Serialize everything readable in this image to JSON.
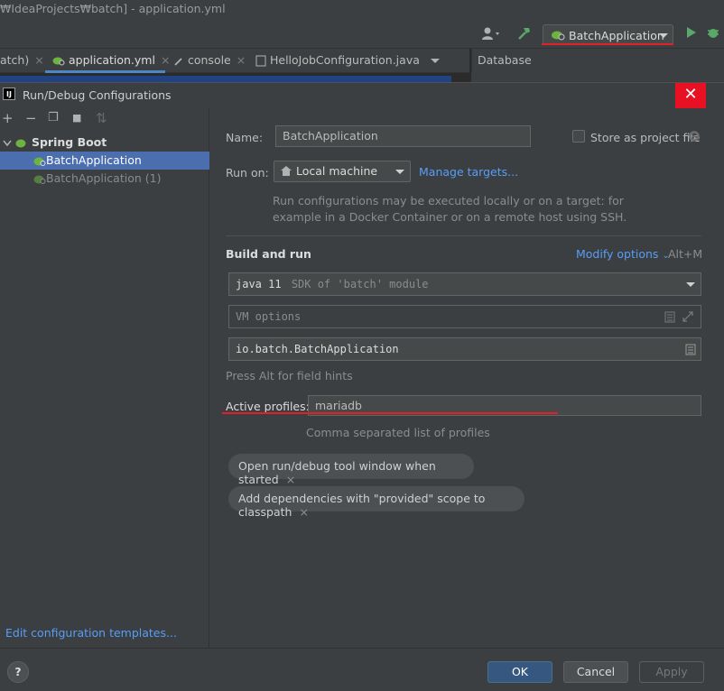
{
  "ide": {
    "window_title": "₩IdeaProjects₩batch] - application.yml",
    "run_config": "BatchApplication",
    "tabs": [
      {
        "label": "atch)"
      },
      {
        "label": "application.yml"
      },
      {
        "label": "console"
      },
      {
        "label": "HelloJobConfiguration.java"
      }
    ],
    "tab_close": "×",
    "database_label": "Database"
  },
  "dialog": {
    "title": "Run/Debug Configurations",
    "logo_text": "IJ",
    "close_glyph": "✕",
    "toolbar": {
      "add": "+",
      "remove": "−",
      "copy": "❐",
      "folder": "■",
      "sort": "⇅"
    },
    "tree": {
      "group_label": "Spring Boot",
      "items": [
        {
          "label": "BatchApplication",
          "selected": true
        },
        {
          "label": "BatchApplication (1)",
          "selected": false
        }
      ]
    },
    "edit_templates_link": "Edit configuration templates...",
    "name_label": "Name:",
    "name_value": "BatchApplication",
    "store_label": "Store as project file",
    "run_on_label": "Run on:",
    "run_on_value": "Local machine",
    "manage_targets": "Manage targets...",
    "run_on_hint_line1": "Run configurations may be executed locally or on a target: for",
    "run_on_hint_line2": "example in a Docker Container or on a remote host using SSH.",
    "build_run_label": "Build and run",
    "modify_options": "Modify options",
    "modify_shortcut": "Alt+M",
    "sdk_value": "java 11",
    "sdk_hint": "SDK of 'batch' module",
    "vm_placeholder": "VM options",
    "main_class": "io.batch.BatchApplication",
    "field_hints": "Press Alt for field hints",
    "active_profiles_label": "Active profiles:",
    "active_profiles_value": "mariadb",
    "profiles_hint": "Comma separated list of profiles",
    "chip_open_tool_window": "Open run/debug tool window when started",
    "chip_add_dependencies": "Add dependencies with \"provided\" scope to classpath",
    "chip_close": "×",
    "help": "?",
    "ok": "OK",
    "cancel": "Cancel",
    "apply": "Apply"
  },
  "colors": {
    "accent": "#4b6eaf",
    "link": "#589df6",
    "highlight_red": "#e0202b",
    "close_red": "#e81123",
    "spring_green": "#6db33f"
  }
}
